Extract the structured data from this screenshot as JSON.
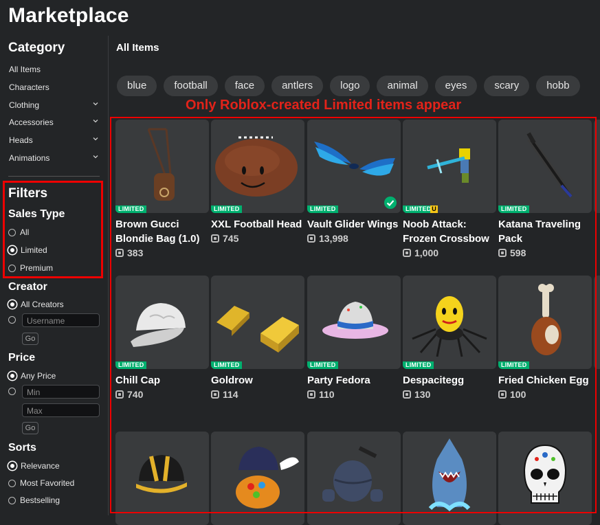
{
  "page": {
    "title": "Marketplace"
  },
  "category": {
    "heading": "Category",
    "items": [
      {
        "label": "All Items",
        "dropdown": false
      },
      {
        "label": "Characters",
        "dropdown": false
      },
      {
        "label": "Clothing",
        "dropdown": true
      },
      {
        "label": "Accessories",
        "dropdown": true
      },
      {
        "label": "Heads",
        "dropdown": true
      },
      {
        "label": "Animations",
        "dropdown": true
      }
    ]
  },
  "filters": {
    "heading": "Filters",
    "sales_type": {
      "label": "Sales Type",
      "options": [
        "All",
        "Limited",
        "Premium"
      ],
      "selected": "Limited"
    },
    "creator": {
      "label": "Creator",
      "options": [
        "All Creators"
      ],
      "selected": "All Creators",
      "username_placeholder": "Username",
      "go": "Go"
    },
    "price": {
      "label": "Price",
      "options": [
        "Any Price"
      ],
      "selected": "Any Price",
      "min_placeholder": "Min",
      "max_placeholder": "Max",
      "go": "Go"
    },
    "sorts": {
      "label": "Sorts",
      "options": [
        "Relevance",
        "Most Favorited",
        "Bestselling"
      ],
      "selected": "Relevance"
    }
  },
  "main": {
    "section_title": "All Items",
    "chips": [
      "blue",
      "football",
      "face",
      "antlers",
      "logo",
      "animal",
      "eyes",
      "scary",
      "hobb"
    ],
    "annotation": "Only Roblox-created Limited items appear",
    "badge_label": "LIMITED",
    "unique_badge": "U",
    "items": [
      {
        "name": "Brown Gucci Blondie Bag (1.0)",
        "price": "383",
        "icon": "brown-bag-icon"
      },
      {
        "name": "XXL Football Head",
        "price": "745",
        "icon": "football-head-icon"
      },
      {
        "name": "Vault Glider Wings",
        "price": "13,998",
        "icon": "blue-wings-icon",
        "owned": true
      },
      {
        "name": "Noob Attack: Frozen Crossbow",
        "price": "1,000",
        "icon": "crossbow-icon",
        "unique": true
      },
      {
        "name": "Katana Traveling Pack",
        "price": "598",
        "icon": "katana-icon"
      },
      {
        "name": "Chill Cap",
        "price": "740",
        "icon": "white-cap-icon"
      },
      {
        "name": "Goldrow",
        "price": "114",
        "icon": "gold-bars-icon"
      },
      {
        "name": "Party Fedora",
        "price": "110",
        "icon": "party-fedora-icon"
      },
      {
        "name": "Despacitegg",
        "price": "130",
        "icon": "spider-egg-icon"
      },
      {
        "name": "Fried Chicken Egg",
        "price": "100",
        "icon": "chicken-leg-icon"
      },
      {
        "name": "",
        "price": "",
        "icon": "black-helmet-icon"
      },
      {
        "name": "",
        "price": "",
        "icon": "treasure-egg-icon"
      },
      {
        "name": "",
        "price": "",
        "icon": "robot-head-icon"
      },
      {
        "name": "",
        "price": "",
        "icon": "shark-hat-icon"
      },
      {
        "name": "",
        "price": "",
        "icon": "sugar-skull-icon"
      }
    ]
  },
  "colors": {
    "background": "#232527",
    "card": "#393b3d",
    "limited_badge": "#00b06f",
    "annotation": "#e2231a"
  }
}
